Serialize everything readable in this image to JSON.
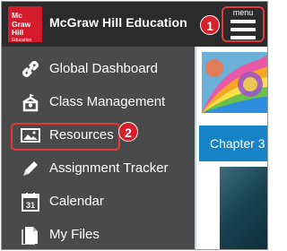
{
  "header": {
    "logo": {
      "line1": "Mc",
      "line2": "Graw",
      "line3": "Hill",
      "line4": "Education"
    },
    "title": "McGraw Hill Education",
    "menu_caption": "menu",
    "badge1": "1"
  },
  "sidebar": {
    "items": [
      {
        "label": "Global Dashboard",
        "icon": "link-icon"
      },
      {
        "label": "Class Management",
        "icon": "school-building-icon"
      },
      {
        "label": "Resources",
        "icon": "image-icon"
      },
      {
        "label": "Assignment Tracker",
        "icon": "pencil-icon"
      },
      {
        "label": "Calendar",
        "icon": "calendar-icon"
      },
      {
        "label": "My Files",
        "icon": "file-icon"
      }
    ],
    "calendar_number": "31",
    "badge2": "2"
  },
  "content": {
    "chapter_text": "Chapter 3"
  },
  "colors": {
    "header_bg": "#2b2b2b",
    "sidebar_bg": "#4a4a4a",
    "logo_red": "#d41b2c",
    "highlight_red": "#e03a3a",
    "badge_red": "#d6202a",
    "chapter_blue": "#1583c6"
  }
}
